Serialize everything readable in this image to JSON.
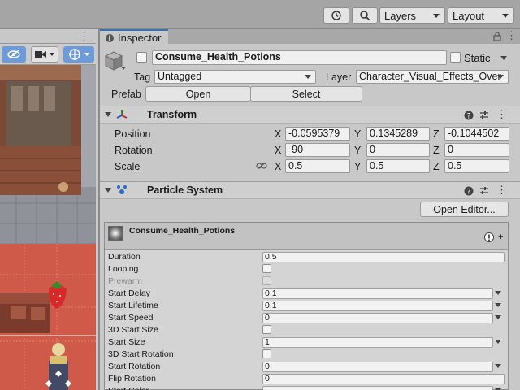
{
  "toolbar": {
    "layers_label": "Layers",
    "layout_label": "Layout",
    "history_icon": "history-icon",
    "search_icon": "search-icon"
  },
  "scene": {
    "menu_dots": "⋮",
    "tools": [
      "visibility-toggle-icon",
      "camera-icon",
      "gizmo-icon"
    ]
  },
  "inspector": {
    "tab_label": "Inspector",
    "object": {
      "name": "Consume_Health_Potions",
      "static_label": "Static",
      "tag_label": "Tag",
      "tag_value": "Untagged",
      "layer_label": "Layer",
      "layer_value": "Character_Visual_Effects_Over",
      "prefab_label": "Prefab",
      "open_label": "Open",
      "select_label": "Select"
    },
    "transform": {
      "title": "Transform",
      "position_label": "Position",
      "rotation_label": "Rotation",
      "scale_label": "Scale",
      "x": "X",
      "y": "Y",
      "z": "Z",
      "position": [
        "-0.0595379",
        "0.1345289",
        "-0.1044502"
      ],
      "rotation": [
        "-90",
        "0",
        "0"
      ],
      "scale": [
        "0.5",
        "0.5",
        "0.5"
      ]
    },
    "particle_system": {
      "title": "Particle System",
      "open_editor_label": "Open Editor...",
      "module_title": "Consume_Health_Potions",
      "rows": [
        {
          "label": "Duration",
          "value": "0.5",
          "kind": "field"
        },
        {
          "label": "Looping",
          "value": "",
          "kind": "check"
        },
        {
          "label": "Prewarm",
          "value": "",
          "kind": "check-disabled"
        },
        {
          "label": "Start Delay",
          "value": "0.1",
          "kind": "drop"
        },
        {
          "label": "Start Lifetime",
          "value": "0.1",
          "kind": "drop"
        },
        {
          "label": "Start Speed",
          "value": "0",
          "kind": "drop"
        },
        {
          "label": "3D Start Size",
          "value": "",
          "kind": "check"
        },
        {
          "label": "Start Size",
          "value": "1",
          "kind": "drop"
        },
        {
          "label": "3D Start Rotation",
          "value": "",
          "kind": "check"
        },
        {
          "label": "Start Rotation",
          "value": "0",
          "kind": "drop"
        },
        {
          "label": "Flip Rotation",
          "value": "0",
          "kind": "field"
        },
        {
          "label": "Start Color",
          "value": "",
          "kind": "drop"
        }
      ]
    }
  }
}
